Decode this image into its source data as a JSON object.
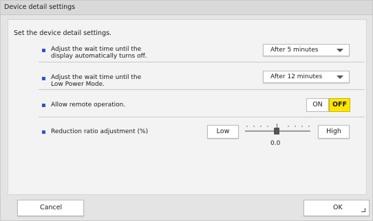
{
  "dialog": {
    "title": "Device detail settings",
    "intro": "Set the device detail settings."
  },
  "settings": {
    "display_off": {
      "label_line1": "Adjust the wait time until the",
      "label_line2": "display automatically turns off.",
      "value": "After 5 minutes"
    },
    "low_power": {
      "label_line1": "Adjust the wait time until the",
      "label_line2": "Low Power Mode.",
      "value": "After 12 minutes"
    },
    "remote": {
      "label": "Allow remote operation.",
      "on_label": "ON",
      "off_label": "OFF",
      "selected": "OFF"
    },
    "reduction": {
      "label": "Reduction ratio adjustment (%)",
      "low_label": "Low",
      "high_label": "High",
      "value": "0.0"
    }
  },
  "footer": {
    "cancel_label": "Cancel",
    "ok_label": "OK"
  },
  "colors": {
    "bullet": "#2b55c9",
    "selected_toggle": "#ffe600"
  }
}
